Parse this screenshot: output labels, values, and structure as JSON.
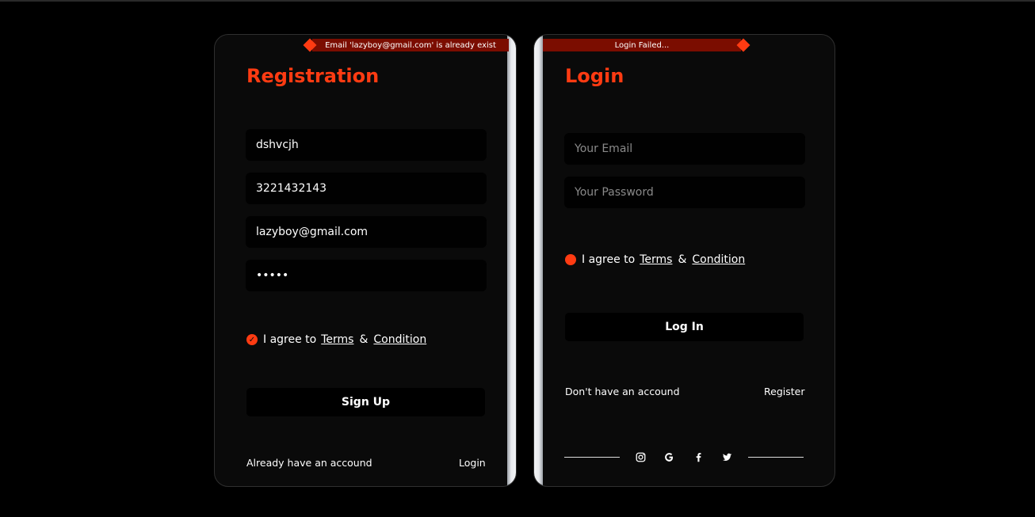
{
  "register": {
    "toast": "Email 'lazyboy@gmail.com' is already exist",
    "title": "Registration",
    "fields": {
      "name": "dshvcjh",
      "phone": "3221432143",
      "email": "lazyboy@gmail.com",
      "password": "•••••"
    },
    "agree": {
      "prefix": "I agree to",
      "terms": "Terms",
      "amp": "&",
      "condition": "Condition"
    },
    "button": "Sign Up",
    "footer": {
      "text": "Already have an accound",
      "link": "Login"
    }
  },
  "login": {
    "toast": "Login Failed...",
    "title": "Login",
    "fields": {
      "email_placeholder": "Your Email",
      "password_placeholder": "Your Password"
    },
    "agree": {
      "prefix": "I agree to",
      "terms": "Terms",
      "amp": "&",
      "condition": "Condition"
    },
    "button": "Log In",
    "footer": {
      "text": "Don't have an accound",
      "link": "Register"
    },
    "social": [
      "instagram-icon",
      "google-icon",
      "facebook-icon",
      "twitter-icon"
    ]
  },
  "colors": {
    "accent": "#ff3b12",
    "toast_bg": "#7b0d00",
    "card_bg": "#0a0a0a",
    "field_bg": "#010101"
  }
}
